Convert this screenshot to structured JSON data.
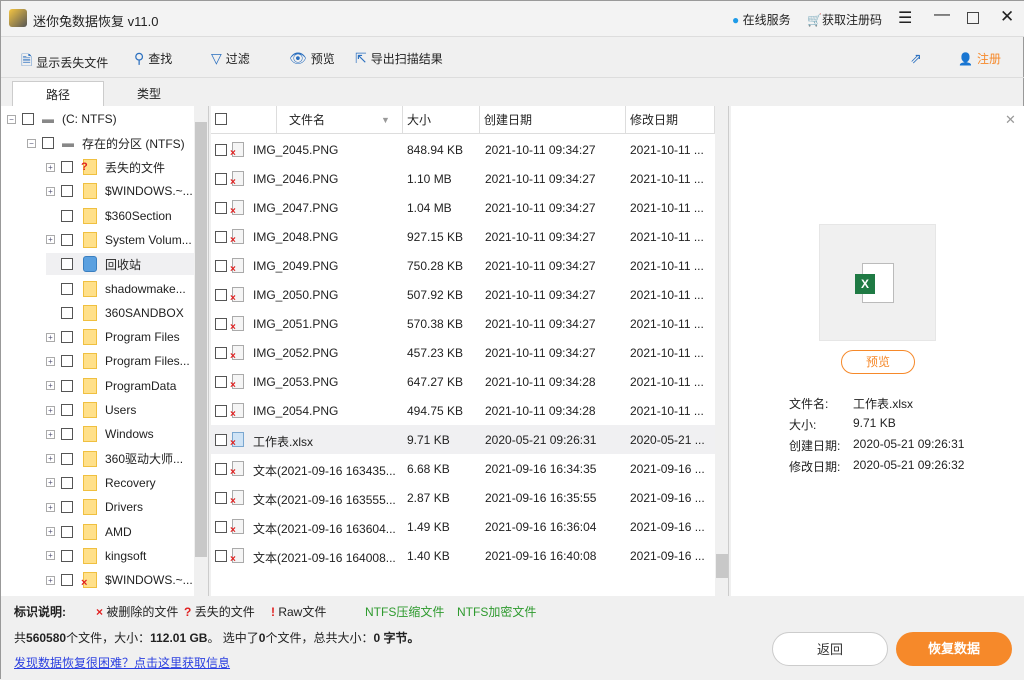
{
  "app": {
    "title": "迷你兔数据恢复 v11.0",
    "online_service": "在线服务",
    "get_code": "获取注册码"
  },
  "colors": {
    "accent": "#f6892a",
    "link": "#2a6fbf",
    "ntfs_green": "#2e9a2e",
    "deleted_red": "#e02020"
  },
  "toolbar": {
    "show_lost": "显示丢失文件",
    "find": "查找",
    "filter": "过滤",
    "preview": "预览",
    "export": "导出扫描结果",
    "register": "注册"
  },
  "tabs": [
    {
      "label": "路径"
    },
    {
      "label": "类型"
    }
  ],
  "tree": {
    "root": "(C: NTFS)",
    "partition": "存在的分区 (NTFS)",
    "items": [
      {
        "label": "丢失的文件",
        "expand": true,
        "mark": "?"
      },
      {
        "label": "$WINDOWS.~...",
        "expand": true
      },
      {
        "label": "$360Section",
        "expand": false
      },
      {
        "label": "System Volum...",
        "expand": true
      },
      {
        "label": "回收站",
        "expand": false,
        "icon": "recycle-bin"
      },
      {
        "label": "shadowmake...",
        "expand": false
      },
      {
        "label": "360SANDBOX",
        "expand": false
      },
      {
        "label": "Program Files",
        "expand": true
      },
      {
        "label": "Program Files...",
        "expand": true
      },
      {
        "label": "ProgramData",
        "expand": true
      },
      {
        "label": "Users",
        "expand": true
      },
      {
        "label": "Windows",
        "expand": true
      },
      {
        "label": "360驱动大师...",
        "expand": true
      },
      {
        "label": "Recovery",
        "expand": true
      },
      {
        "label": "Drivers",
        "expand": true
      },
      {
        "label": "AMD",
        "expand": true
      },
      {
        "label": "kingsoft",
        "expand": true
      },
      {
        "label": "$WINDOWS.~...",
        "expand": true,
        "mark": "x"
      }
    ]
  },
  "files": {
    "columns": [
      "文件名",
      "大小",
      "创建日期",
      "修改日期"
    ],
    "rows": [
      [
        "IMG_2045.PNG",
        "848.94 KB",
        "2021-10-11 09:34:27",
        "2021-10-11 ..."
      ],
      [
        "IMG_2046.PNG",
        "1.10 MB",
        "2021-10-11 09:34:27",
        "2021-10-11 ..."
      ],
      [
        "IMG_2047.PNG",
        "1.04 MB",
        "2021-10-11 09:34:27",
        "2021-10-11 ..."
      ],
      [
        "IMG_2048.PNG",
        "927.15 KB",
        "2021-10-11 09:34:27",
        "2021-10-11 ..."
      ],
      [
        "IMG_2049.PNG",
        "750.28 KB",
        "2021-10-11 09:34:27",
        "2021-10-11 ..."
      ],
      [
        "IMG_2050.PNG",
        "507.92 KB",
        "2021-10-11 09:34:27",
        "2021-10-11 ..."
      ],
      [
        "IMG_2051.PNG",
        "570.38 KB",
        "2021-10-11 09:34:27",
        "2021-10-11 ..."
      ],
      [
        "IMG_2052.PNG",
        "457.23 KB",
        "2021-10-11 09:34:27",
        "2021-10-11 ..."
      ],
      [
        "IMG_2053.PNG",
        "647.27 KB",
        "2021-10-11 09:34:28",
        "2021-10-11 ..."
      ],
      [
        "IMG_2054.PNG",
        "494.75 KB",
        "2021-10-11 09:34:28",
        "2021-10-11 ..."
      ],
      [
        "工作表.xlsx",
        "9.71 KB",
        "2020-05-21 09:26:31",
        "2020-05-21 ..."
      ],
      [
        "文本(2021-09-16 163435...",
        "6.68 KB",
        "2021-09-16 16:34:35",
        "2021-09-16 ..."
      ],
      [
        "文本(2021-09-16 163555...",
        "2.87 KB",
        "2021-09-16 16:35:55",
        "2021-09-16 ..."
      ],
      [
        "文本(2021-09-16 163604...",
        "1.49 KB",
        "2021-09-16 16:36:04",
        "2021-09-16 ..."
      ],
      [
        "文本(2021-09-16 164008...",
        "1.40 KB",
        "2021-09-16 16:40:08",
        "2021-09-16 ..."
      ]
    ],
    "selected_index": 10
  },
  "preview": {
    "button": "预览",
    "name_label": "文件名:",
    "name": "工作表.xlsx",
    "size_label": "大小:",
    "size": "9.71 KB",
    "created_label": "创建日期:",
    "created": "2020-05-21 09:26:31",
    "modified_label": "修改日期:",
    "modified": "2020-05-21 09:26:32"
  },
  "legend": {
    "title": "标识说明:",
    "deleted": "被删除的文件",
    "lost": "丢失的文件",
    "raw": "Raw文件",
    "ntfs_compressed": "NTFS压缩文件",
    "ntfs_encrypted": "NTFS加密文件"
  },
  "status": {
    "p1": "共",
    "count": "560580",
    "p2": "个文件，大小：",
    "size": "112.01 GB",
    "p3": "。 选中了",
    "selected": "0",
    "p4": "个文件，总共大小：",
    "total": "0",
    "p5": " 字节。"
  },
  "help_link": "发现数据恢复很困难？点击这里获取信息",
  "buttons": {
    "back": "返回",
    "recover": "恢复数据"
  }
}
